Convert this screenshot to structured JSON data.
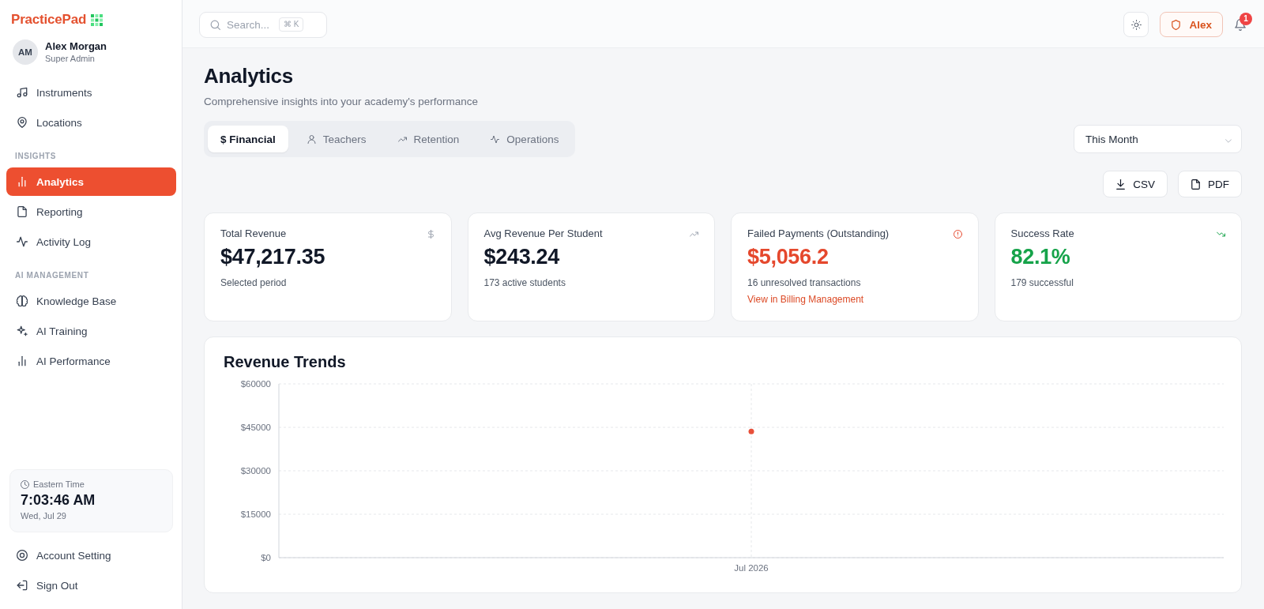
{
  "sidebar": {
    "brand": "PracticePad",
    "user": {
      "initials": "AM",
      "name": "Alex Morgan",
      "role": "Super Admin"
    },
    "sections": [
      {
        "items": [
          {
            "label": "Instruments",
            "selected": false
          },
          {
            "label": "Locations",
            "selected": false
          }
        ]
      },
      {
        "heading": "INSIGHTS",
        "items": [
          {
            "label": "Analytics",
            "selected": true
          },
          {
            "label": "Reporting",
            "selected": false
          },
          {
            "label": "Activity Log",
            "selected": false
          }
        ]
      },
      {
        "heading": "AI MANAGEMENT",
        "items": [
          {
            "label": "Knowledge Base",
            "selected": false
          },
          {
            "label": "AI Training",
            "selected": false
          },
          {
            "label": "AI Performance",
            "selected": false
          }
        ]
      }
    ],
    "clock": {
      "zone": "Eastern Time",
      "time": "7:03:46 AM",
      "date": "Wed, Jul 29"
    },
    "footer_items": [
      "Account Setting",
      "Sign Out"
    ]
  },
  "top_bar": {
    "search": {
      "placeholder": "Search...",
      "shortcut": "⌘ K"
    },
    "user_button": "Alex",
    "notifications": {
      "count": "1"
    }
  },
  "page": {
    "title": "Analytics",
    "subtitle": "Comprehensive insights into your academy's performance",
    "tabs": [
      {
        "label": "$ Financial",
        "selected": true
      },
      {
        "label": "Teachers",
        "selected": false
      },
      {
        "label": "Retention",
        "selected": false
      },
      {
        "label": "Operations",
        "selected": false
      }
    ],
    "period_select": {
      "value": "This Month"
    },
    "export_buttons": [
      "CSV",
      "PDF"
    ],
    "stats": [
      {
        "kind": "neutral",
        "title": "Total Revenue",
        "value": "$47,217.35",
        "note": "Selected period"
      },
      {
        "kind": "neutral",
        "title": "Avg Revenue Per Student",
        "value": "$243.24",
        "note": "173 active students"
      },
      {
        "kind": "danger",
        "title": "Failed Payments (Outstanding)",
        "value": "$5,056.2",
        "note": "16 unresolved transactions",
        "link": "View in Billing Management"
      },
      {
        "kind": "success",
        "title": "Success Rate",
        "value": "82.1%",
        "note": "179 successful"
      }
    ],
    "revenue_chart": {
      "chart_data": {
        "type": "line",
        "title": "Revenue Trends",
        "grid": true,
        "x": [
          "Jul 2026"
        ],
        "series": [
          {
            "color": "#e8503a",
            "marker": "circle",
            "values": [
              43600
            ]
          }
        ],
        "ylim": [
          0,
          60000
        ],
        "yticks": [
          {
            "value": 0,
            "label": "$0"
          },
          {
            "value": 15000,
            "label": "$15000"
          },
          {
            "value": 30000,
            "label": "$30000"
          },
          {
            "value": 45000,
            "label": "$45000"
          },
          {
            "value": 60000,
            "label": "$60000"
          }
        ]
      }
    }
  }
}
